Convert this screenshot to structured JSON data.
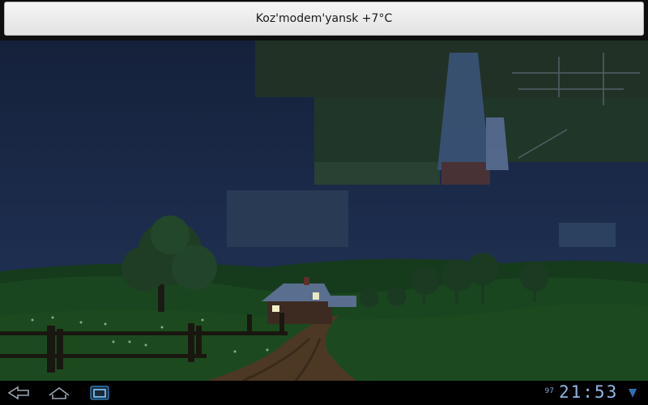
{
  "header": {
    "title": "Koz'modem'yansk +7°C"
  },
  "status_bar": {
    "battery": "97",
    "clock": "21:53"
  },
  "nav": {
    "back_icon": "back-arrow-icon",
    "home_icon": "home-icon",
    "recent_icon": "recent-apps-icon",
    "signal_icon": "signal-icon"
  },
  "colors": {
    "sky": "#1a2a4e",
    "hills": "#173c1a",
    "accent": "#8fb8e6"
  }
}
